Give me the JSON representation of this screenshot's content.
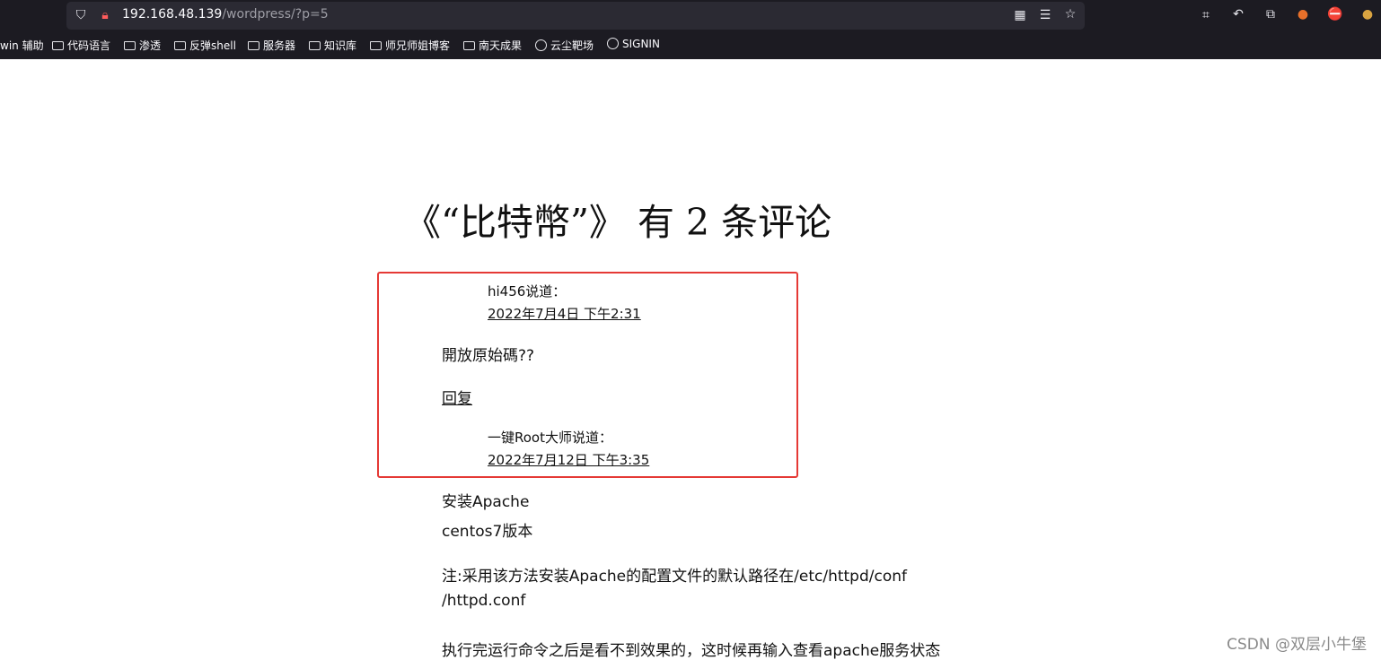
{
  "browser": {
    "url_host": "192.168.48.139",
    "url_path": "/wordpress/?p=5",
    "bookmarks": [
      {
        "label": "win 辅助",
        "type": "text"
      },
      {
        "label": "代码语言",
        "type": "folder"
      },
      {
        "label": "渗透",
        "type": "folder"
      },
      {
        "label": "反弹shell",
        "type": "folder"
      },
      {
        "label": "服务器",
        "type": "folder"
      },
      {
        "label": "知识库",
        "type": "folder"
      },
      {
        "label": "师兄师姐博客",
        "type": "folder"
      },
      {
        "label": "南天成果",
        "type": "folder"
      },
      {
        "label": "云尘靶场",
        "type": "site"
      },
      {
        "label": "SIGNIN",
        "type": "site"
      }
    ]
  },
  "page": {
    "comments_title": "《“比特幣”》 有 2 条评论",
    "comment1": {
      "author_says": "hi456说道：",
      "date": "2022年7月4日 下午2:31",
      "body": "開放原始碼??",
      "reply": "回复"
    },
    "comment2": {
      "author_says": "一键Root大师说道：",
      "date": "2022年7月12日 下午3:35",
      "body_lines": [
        "安装Apache",
        "centos7版本",
        "注:采用该方法安装Apache的配置文件的默认路径在/etc/httpd/conf",
        "/httpd.conf",
        "执行完运行命令之后是看不到效果的，这时候再输入查看apache服务状态"
      ]
    }
  },
  "watermark": "CSDN @双层小牛堡",
  "colors": {
    "highlight_box": "#e53935",
    "chrome_bg": "#1c1b22"
  }
}
